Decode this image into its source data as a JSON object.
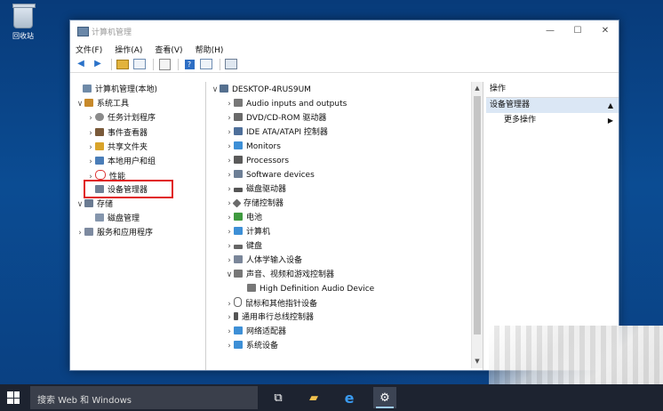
{
  "desktop": {
    "recycle_bin_label": "回收站"
  },
  "window": {
    "title": "计算机管理",
    "controls": {
      "minimize": "—",
      "maximize": "☐",
      "close": "✕"
    }
  },
  "menu": [
    "文件(F)",
    "操作(A)",
    "查看(V)",
    "帮助(H)"
  ],
  "toolbar_icons": [
    "back-arrow-icon",
    "forward-arrow-icon",
    "up-folder-icon",
    "show-tree-icon",
    "properties-icon",
    "help-icon",
    "console-view-icon",
    "scan-hardware-icon"
  ],
  "left_tree": [
    {
      "label": "计算机管理(本地)",
      "arrow": "",
      "icon": "computer-management-icon",
      "level": 0,
      "color": "#6f8aa8"
    },
    {
      "label": "系统工具",
      "arrow": "∨",
      "icon": "system-tools-icon",
      "level": 1,
      "color": "#c7892a"
    },
    {
      "label": "任务计划程序",
      "arrow": "›",
      "icon": "task-scheduler-icon",
      "level": 2,
      "color": "#8b8b8b"
    },
    {
      "label": "事件查看器",
      "arrow": "›",
      "icon": "event-viewer-icon",
      "level": 2,
      "color": "#7a5a3a"
    },
    {
      "label": "共享文件夹",
      "arrow": "›",
      "icon": "shared-folders-icon",
      "level": 2,
      "color": "#d9a42b"
    },
    {
      "label": "本地用户和组",
      "arrow": "›",
      "icon": "users-groups-icon",
      "level": 2,
      "color": "#4a7db8"
    },
    {
      "label": "性能",
      "arrow": "›",
      "icon": "performance-icon",
      "level": 2,
      "color": "#d33"
    },
    {
      "label": "设备管理器",
      "arrow": "",
      "icon": "device-manager-icon",
      "level": 2,
      "color": "#707f95"
    },
    {
      "label": "存储",
      "arrow": "∨",
      "icon": "storage-icon",
      "level": 1,
      "color": "#6a7b92"
    },
    {
      "label": "磁盘管理",
      "arrow": "",
      "icon": "disk-management-icon",
      "level": 2,
      "color": "#8596ad"
    },
    {
      "label": "服务和应用程序",
      "arrow": "›",
      "icon": "services-apps-icon",
      "level": 1,
      "color": "#7d8aa0"
    }
  ],
  "device_tree": [
    {
      "label": "DESKTOP-4RUS9UM",
      "arrow": "∨",
      "icon": "computer-icon",
      "level": 0,
      "color": "#55708f"
    },
    {
      "label": "Audio inputs and outputs",
      "arrow": "›",
      "icon": "speaker-icon",
      "level": 1,
      "color": "#777"
    },
    {
      "label": "DVD/CD-ROM 驱动器",
      "arrow": "›",
      "icon": "dvd-drive-icon",
      "level": 1,
      "color": "#6a6a6a"
    },
    {
      "label": "IDE ATA/ATAPI 控制器",
      "arrow": "›",
      "icon": "ide-controller-icon",
      "level": 1,
      "color": "#4e6f9a"
    },
    {
      "label": "Monitors",
      "arrow": "›",
      "icon": "monitor-icon",
      "level": 1,
      "color": "#3d8fd6"
    },
    {
      "label": "Processors",
      "arrow": "›",
      "icon": "processor-icon",
      "level": 1,
      "color": "#5a5a5a"
    },
    {
      "label": "Software devices",
      "arrow": "›",
      "icon": "software-device-icon",
      "level": 1,
      "color": "#6d7f96"
    },
    {
      "label": "磁盘驱动器",
      "arrow": "›",
      "icon": "disk-drive-icon",
      "level": 1,
      "color": "#555"
    },
    {
      "label": "存储控制器",
      "arrow": "›",
      "icon": "storage-controller-icon",
      "level": 1,
      "color": "#6b6b6b"
    },
    {
      "label": "电池",
      "arrow": "›",
      "icon": "battery-icon",
      "level": 1,
      "color": "#3f9a3f"
    },
    {
      "label": "计算机",
      "arrow": "›",
      "icon": "computer-icon",
      "level": 1,
      "color": "#3d8fd6"
    },
    {
      "label": "键盘",
      "arrow": "›",
      "icon": "keyboard-icon",
      "level": 1,
      "color": "#666"
    },
    {
      "label": "人体学输入设备",
      "arrow": "›",
      "icon": "hid-icon",
      "level": 1,
      "color": "#7a8699"
    },
    {
      "label": "声音、视频和游戏控制器",
      "arrow": "∨",
      "icon": "sound-controller-icon",
      "level": 1,
      "color": "#777"
    },
    {
      "label": "High Definition Audio Device",
      "arrow": "",
      "icon": "audio-device-icon",
      "level": 2,
      "color": "#777"
    },
    {
      "label": "鼠标和其他指针设备",
      "arrow": "›",
      "icon": "mouse-icon",
      "level": 1,
      "color": "#666"
    },
    {
      "label": "通用串行总线控制器",
      "arrow": "›",
      "icon": "usb-controller-icon",
      "level": 1,
      "color": "#555"
    },
    {
      "label": "网络适配器",
      "arrow": "›",
      "icon": "network-adapter-icon",
      "level": 1,
      "color": "#3d8fd6"
    },
    {
      "label": "系统设备",
      "arrow": "›",
      "icon": "system-device-icon",
      "level": 1,
      "color": "#3d8fd6"
    }
  ],
  "actions": {
    "header": "操作",
    "selected": "设备管理器",
    "more": "更多操作",
    "collapse_arrow": "▲",
    "more_arrow": "▶"
  },
  "scrollbar": {
    "up": "▲",
    "down": "▼"
  },
  "taskbar": {
    "search_placeholder": "搜索 Web 和 Windows",
    "task_view_glyph": "⧉",
    "explorer_glyph": "▰",
    "edge_glyph": "e",
    "computer_mgmt_glyph": "⚙"
  },
  "colors": {
    "desktop": "#0b4c93",
    "taskbar": "#1d2330",
    "highlight_border": "#e01c1c",
    "action_selected": "#dbe7f5"
  }
}
